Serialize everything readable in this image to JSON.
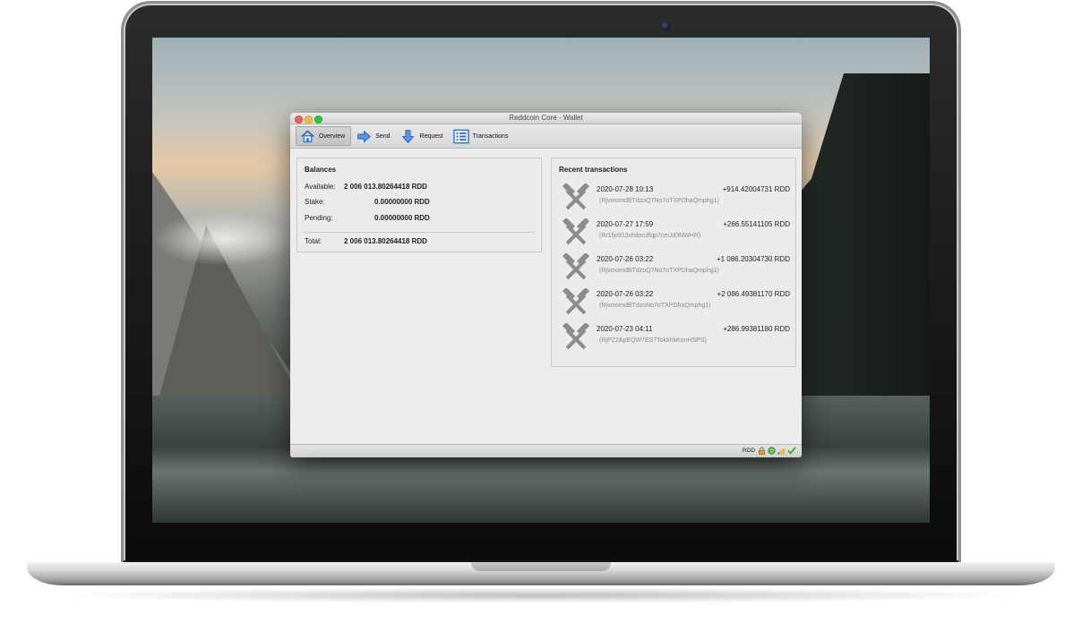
{
  "window": {
    "title": "Reddcoin Core - Wallet"
  },
  "toolbar": {
    "items": [
      {
        "label": "Overview",
        "icon": "home-icon",
        "active": true
      },
      {
        "label": "Send",
        "icon": "send-arrow-icon",
        "active": false
      },
      {
        "label": "Request",
        "icon": "receive-arrow-icon",
        "active": false
      },
      {
        "label": "Transactions",
        "icon": "transactions-list-icon",
        "active": false
      }
    ]
  },
  "balances": {
    "title": "Balances",
    "available_label": "Available:",
    "available_value": "2 006 013.80264418 RDD",
    "stake_label": "Stake:",
    "stake_value": "0.00000000 RDD",
    "pending_label": "Pending:",
    "pending_value": "0.00000000 RDD",
    "total_label": "Total:",
    "total_value": "2 006 013.80264418 RDD"
  },
  "recent": {
    "title": "Recent transactions",
    "icon": "mined-hammers-icon",
    "items": [
      {
        "date": "2020-07-28 10:13",
        "amount": "+914.42004731 RDD",
        "address": "(RjvmomdBTdzoQ7No7oTXPDhaQmphg1)"
      },
      {
        "date": "2020-07-27 17:59",
        "amount": "+266.55141105 RDD",
        "address": "(Rr1fjo913xhibrcdfqp7ceiJd3NWHR)"
      },
      {
        "date": "2020-07-26 03:22",
        "amount": "+1 086.20304730 RDD",
        "address": "(RjvmomdBTdzoQ7No7oTXPDhaQmphg1)"
      },
      {
        "date": "2020-07-26 03:22",
        "amount": "+2 086.49381170 RDD",
        "address": "(RjvmomdBTdzoNo7oTXPDhaQmphg1)"
      },
      {
        "date": "2020-07-23 04:11",
        "amount": "+286.99381180 RDD",
        "address": "(RjPZ2ApEQW7ES7TokkhkKonHSPS)"
      }
    ]
  },
  "statusbar": {
    "unit": "RDD",
    "icons": [
      "lock-icon",
      "staking-globe-icon",
      "signal-bars-icon",
      "synced-check-icon"
    ]
  },
  "colors": {
    "close": "#fc5f57",
    "minimize": "#fdbc2e",
    "maximize": "#29c840",
    "toolbar_icon_blue": "#2c6fd1"
  }
}
